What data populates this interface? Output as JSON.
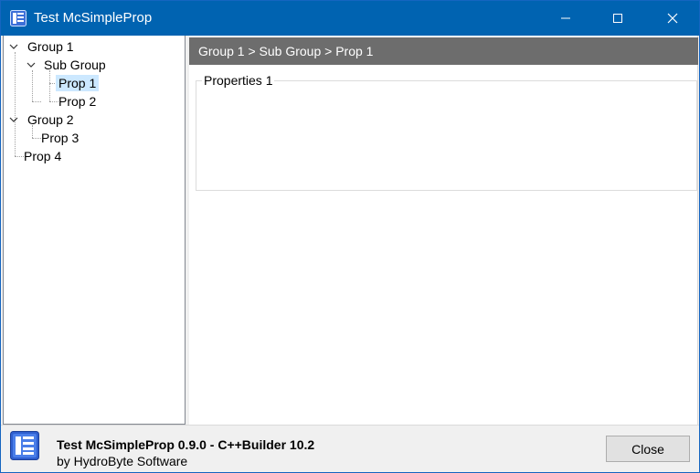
{
  "window": {
    "title": "Test McSimpleProp",
    "title_bar_color": "#0063b1",
    "buttons": {
      "minimize_icon": "minimize-icon",
      "maximize_icon": "maximize-icon",
      "close_icon": "close-icon"
    }
  },
  "tree": {
    "nodes": [
      {
        "label": "Group 1",
        "level": 0,
        "expanded": true
      },
      {
        "label": "Sub Group",
        "level": 1,
        "expanded": true
      },
      {
        "label": "Prop 1",
        "level": 2,
        "selected": true
      },
      {
        "label": "Prop 2",
        "level": 2
      },
      {
        "label": "Group 2",
        "level": 0,
        "expanded": true
      },
      {
        "label": "Prop 3",
        "level": 1
      },
      {
        "label": "Prop 4",
        "level": 0
      }
    ],
    "selection_color": "#cce8ff"
  },
  "content": {
    "breadcrumb": "Group 1 > Sub Group > Prop 1",
    "breadcrumb_bg": "#6d6d6d",
    "groupbox_caption": "Properties 1"
  },
  "footer": {
    "title": "Test McSimpleProp 0.9.0 - C++Builder 10.2",
    "subtitle": "by HydroByte Software",
    "close_label": "Close"
  }
}
